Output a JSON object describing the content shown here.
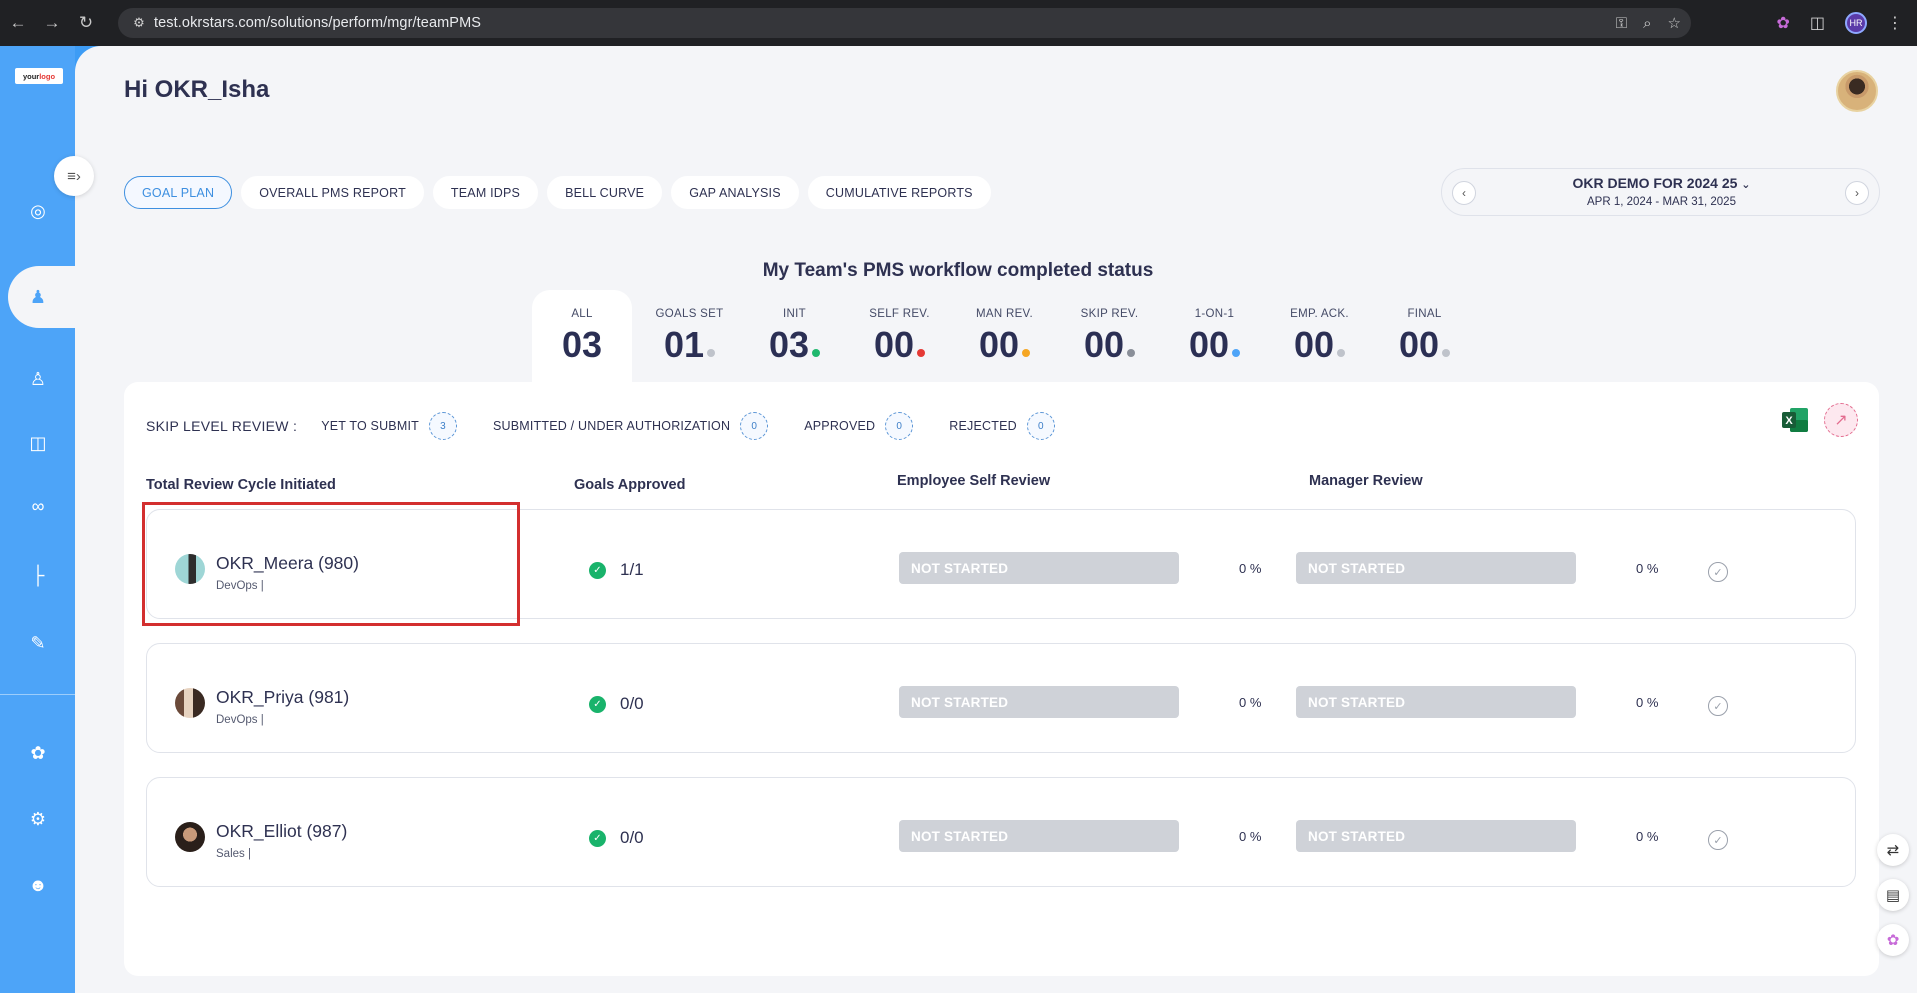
{
  "browser": {
    "url": "test.okrstars.com/solutions/perform/mgr/teamPMS",
    "profile_initials": "HR"
  },
  "sidebar": {
    "logo_prefix": "your",
    "logo_suffix": "logo",
    "icons": [
      "target-icon",
      "team-icon",
      "person-chart-icon",
      "book-icon",
      "hands-icon",
      "hierarchy-icon",
      "document-edit-icon",
      "brain-icon",
      "gear-icon",
      "support-agent-icon"
    ]
  },
  "header": {
    "greeting": "Hi OKR_Isha"
  },
  "tabs": [
    "GOAL PLAN",
    "OVERALL PMS REPORT",
    "TEAM IDPS",
    "BELL CURVE",
    "GAP ANALYSIS",
    "CUMULATIVE REPORTS"
  ],
  "cycle": {
    "title": "OKR DEMO FOR 2024 25",
    "dates": "APR 1, 2024 - MAR 31, 2025"
  },
  "section_title": "My Team's PMS workflow completed status",
  "status_tabs": [
    {
      "label": "ALL",
      "value": "03",
      "dot": ""
    },
    {
      "label": "GOALS SET",
      "value": "01",
      "dot": "#bfc3cb"
    },
    {
      "label": "INIT",
      "value": "03",
      "dot": "#1fb86e"
    },
    {
      "label": "SELF REV.",
      "value": "00",
      "dot": "#e53935"
    },
    {
      "label": "MAN REV.",
      "value": "00",
      "dot": "#f5a623"
    },
    {
      "label": "SKIP REV.",
      "value": "00",
      "dot": "#8a8f99"
    },
    {
      "label": "1-ON-1",
      "value": "00",
      "dot": "#4da4f8"
    },
    {
      "label": "EMP. ACK.",
      "value": "00",
      "dot": "#bfc3cb"
    },
    {
      "label": "FINAL",
      "value": "00",
      "dot": "#bfc3cb"
    }
  ],
  "skip_review": {
    "label": "SKIP LEVEL REVIEW :",
    "items": [
      {
        "label": "YET TO SUBMIT",
        "count": "3"
      },
      {
        "label": "SUBMITTED / UNDER AUTHORIZATION",
        "count": "0"
      },
      {
        "label": "APPROVED",
        "count": "0"
      },
      {
        "label": "REJECTED",
        "count": "0"
      }
    ]
  },
  "columns": {
    "total": "Total Review Cycle Initiated",
    "goals": "Goals Approved",
    "self_review": "Employee Self Review",
    "manager_review": "Manager Review"
  },
  "employees": [
    {
      "name": "OKR_Meera (980)",
      "dept": "DevOps |",
      "goals": "1/1",
      "self_status": "NOT STARTED",
      "self_pct": "0 %",
      "mgr_status": "NOT STARTED",
      "mgr_pct": "0 %"
    },
    {
      "name": "OKR_Priya (981)",
      "dept": "DevOps |",
      "goals": "0/0",
      "self_status": "NOT STARTED",
      "self_pct": "0 %",
      "mgr_status": "NOT STARTED",
      "mgr_pct": "0 %"
    },
    {
      "name": "OKR_Elliot (987)",
      "dept": "Sales |",
      "goals": "0/0",
      "self_status": "NOT STARTED",
      "self_pct": "0 %",
      "mgr_status": "NOT STARTED",
      "mgr_pct": "0 %"
    }
  ]
}
